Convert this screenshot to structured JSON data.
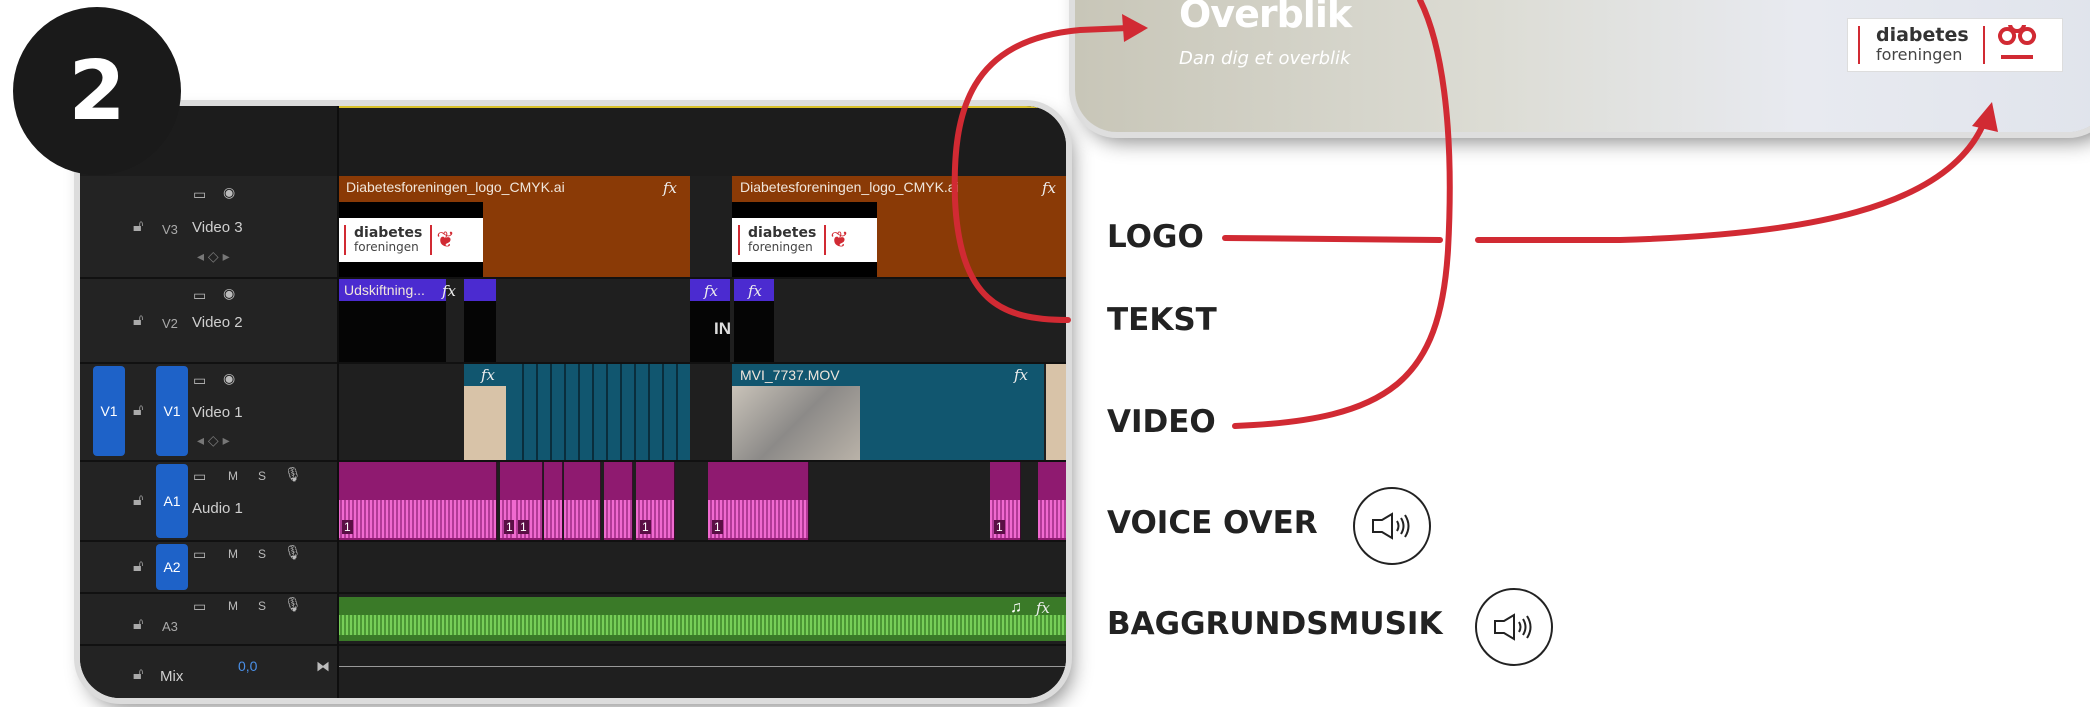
{
  "badge": {
    "number": "2"
  },
  "editor": {
    "tracks": {
      "v3": {
        "target": "V3",
        "name": "Video 3"
      },
      "v2": {
        "target": "V2",
        "name": "Video 2"
      },
      "v1": {
        "source": "V1",
        "target": "V1",
        "name": "Video 1"
      },
      "a1": {
        "target": "A1",
        "name": "Audio 1",
        "m": "M",
        "s": "S"
      },
      "a2": {
        "target": "A2",
        "m": "M",
        "s": "S"
      },
      "a3": {
        "target": "A3",
        "m": "M",
        "s": "S"
      },
      "mix": {
        "name": "Mix",
        "value": "0,0"
      }
    },
    "clips": {
      "logo_clip_1": "Diabetesforeningen_logo_CMYK.ai",
      "logo_clip_2": "Diabetesforeningen_logo_CMYK.ai",
      "text_clip_1": "Udskiftning...",
      "text_clip_in": "IN",
      "video_clip_main": "MVI_7737.MOV",
      "fx": "fx",
      "clip_number": "1"
    },
    "logo": {
      "word1": "diabetes",
      "word2": "foreningen"
    }
  },
  "preview": {
    "title": "Overblik",
    "subtitle": "Dan dig et overblik",
    "logo_word1": "diabetes",
    "logo_word2": "foreningen"
  },
  "labels": {
    "logo": "LOGO",
    "tekst": "TEKST",
    "video": "VIDEO",
    "voice_over": "VOICE OVER",
    "baggrundsmusik": "BAGGRUNDSMUSIK"
  },
  "colors": {
    "accent_red": "#d12a33",
    "clip_orange": "#8a3a06",
    "clip_purple": "#4b2bd0",
    "clip_teal": "#11566f",
    "clip_magenta": "#8f1a70",
    "clip_green": "#3a7a28",
    "target_blue": "#1e62c8"
  },
  "icons": {
    "lock": "lock-icon",
    "eye": "eye-icon",
    "film": "film-icon",
    "mic": "mic-icon",
    "speaker": "speaker-icon",
    "note": "music-note-icon"
  }
}
